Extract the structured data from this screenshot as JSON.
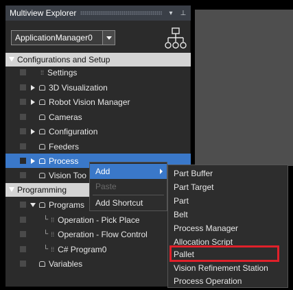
{
  "explorer": {
    "title": "Multiview Explorer",
    "pin_glyph": "▾ ⊥",
    "app_select_value": "ApplicationManager0"
  },
  "tree": {
    "configurations_section": "Configurations and Setup",
    "settings": "Settings",
    "visualization": "3D Visualization",
    "robot_vision": "Robot Vision Manager",
    "cameras": "Cameras",
    "configuration": "Configuration",
    "feeders": "Feeders",
    "process": "Process",
    "vision_tools": "Vision Too",
    "programming_section": "Programming",
    "programs": "Programs",
    "op_pick_place": "Operation - Pick Place",
    "op_flow_control": "Operation - Flow Control",
    "csharp_program": "C# Program0",
    "variables": "Variables"
  },
  "context_menu": {
    "add": "Add",
    "paste": "Paste",
    "add_shortcut": "Add Shortcut"
  },
  "add_submenu": [
    "Part Buffer",
    "Part Target",
    "Part",
    "Belt",
    "Process Manager",
    "Allocation Script",
    "Pallet",
    "Vision Refinement Station",
    "Process Operation"
  ],
  "highlighted_item": "Pallet",
  "colors": {
    "selection": "#3a78c9",
    "highlight_border": "#e0202a",
    "section_bg": "#d4d4d4"
  }
}
